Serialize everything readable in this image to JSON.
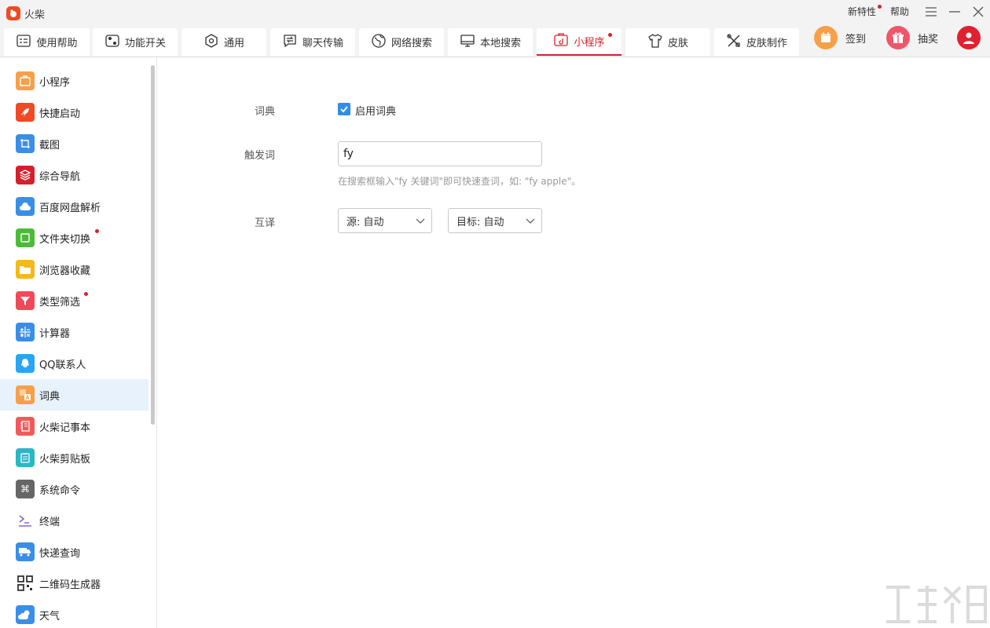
{
  "app": {
    "title": "火柴",
    "brand_color": "#f04a24"
  },
  "titlebar": {
    "new_features": "新特性",
    "help": "帮助",
    "menu_icon": "hamburger-icon",
    "minimize_icon": "minimize-icon",
    "close_icon": "close-icon"
  },
  "tabs": [
    {
      "label": "使用帮助",
      "icon": "help-doc-icon"
    },
    {
      "label": "功能开关",
      "icon": "toggle-icon"
    },
    {
      "label": "通用",
      "icon": "hexagon-icon"
    },
    {
      "label": "聊天传输",
      "icon": "chat-transfer-icon"
    },
    {
      "label": "网络搜索",
      "icon": "globe-icon"
    },
    {
      "label": "本地搜索",
      "icon": "monitor-icon"
    },
    {
      "label": "小程序",
      "icon": "mini-program-icon",
      "active": true,
      "badge": true
    },
    {
      "label": "皮肤",
      "icon": "tshirt-icon"
    },
    {
      "label": "皮肤制作",
      "icon": "tools-icon"
    }
  ],
  "actions": {
    "signin": "签到",
    "lottery": "抽奖"
  },
  "sidebar": {
    "items": [
      {
        "label": "小程序",
        "icon": "mini-program-icon",
        "color": "#f6a04a"
      },
      {
        "label": "快捷启动",
        "icon": "rocket-icon",
        "color": "#f04a24"
      },
      {
        "label": "截图",
        "icon": "screenshot-icon",
        "color": "#3a8ee6"
      },
      {
        "label": "综合导航",
        "icon": "layers-icon",
        "color": "#d4202a"
      },
      {
        "label": "百度网盘解析",
        "icon": "cloud-icon",
        "color": "#3a8ee6"
      },
      {
        "label": "文件夹切换",
        "icon": "folder-switch-icon",
        "color": "#4cbb3a",
        "badge": true
      },
      {
        "label": "浏览器收藏",
        "icon": "folder-icon",
        "color": "#f5b81c"
      },
      {
        "label": "类型筛选",
        "icon": "filter-icon",
        "color": "#f04a5a",
        "badge": true
      },
      {
        "label": "计算器",
        "icon": "calculator-icon",
        "color": "#3a8ee6"
      },
      {
        "label": "QQ联系人",
        "icon": "qq-icon",
        "color": "#2aa4f4"
      },
      {
        "label": "词典",
        "icon": "dictionary-icon",
        "color": "#f6a04a",
        "active": true
      },
      {
        "label": "火柴记事本",
        "icon": "notebook-icon",
        "color": "#f05a5a"
      },
      {
        "label": "火柴剪贴板",
        "icon": "clipboard-icon",
        "color": "#2ab7c6"
      },
      {
        "label": "系统命令",
        "icon": "command-icon",
        "color": "#666666"
      },
      {
        "label": "终端",
        "icon": "terminal-icon",
        "color": "#8a63d2"
      },
      {
        "label": "快递查询",
        "icon": "truck-icon",
        "color": "#3a8ee6"
      },
      {
        "label": "二维码生成器",
        "icon": "qrcode-icon",
        "color": "#333333"
      },
      {
        "label": "天气",
        "icon": "weather-icon",
        "color": "#3a8ee6"
      }
    ]
  },
  "main": {
    "dictionary_label": "词典",
    "enable_dictionary": "启用词典",
    "enable_checked": true,
    "trigger_label": "触发词",
    "trigger_value": "fy",
    "hint": "在搜索框输入\"fy 关键词\"即可快速查词，如: \"fy apple\"。",
    "translate_label": "互译",
    "source_select": "源: 自动",
    "target_select": "目标: 自动"
  }
}
